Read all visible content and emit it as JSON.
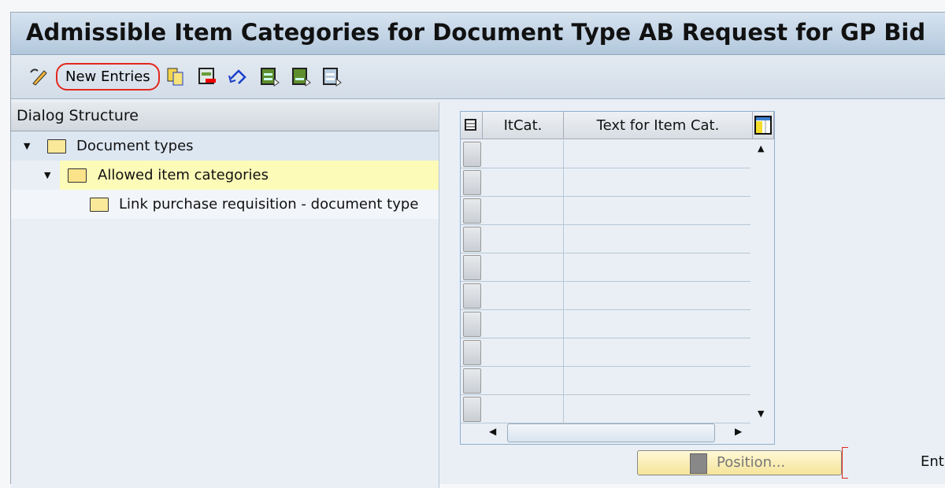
{
  "title": "Admissible Item Categories for Document Type AB Request for GP Bid",
  "toolbar": {
    "new_entries": "New Entries",
    "icons": [
      "change-display-icon",
      "copy-as-icon",
      "delete-icon",
      "undo-icon",
      "select-all-icon",
      "select-block-icon",
      "deselect-all-icon"
    ]
  },
  "dialog_structure": {
    "header": "Dialog Structure",
    "items": [
      {
        "label": "Document types",
        "expanded": true
      },
      {
        "label": "Allowed item categories",
        "expanded": true,
        "selected": true
      },
      {
        "label": "Link purchase requisition - document type"
      }
    ]
  },
  "table": {
    "columns": [
      "ItCat.",
      "Text for Item Cat."
    ],
    "row_count": 10
  },
  "position_button": "Position...",
  "entry_label": "Ent",
  "colors": {
    "highlight": "#fdfbb8",
    "annotation": "#e3281e"
  }
}
